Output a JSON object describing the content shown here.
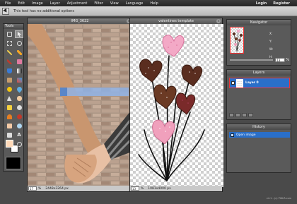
{
  "menu": {
    "items": [
      "File",
      "Edit",
      "Image",
      "Layer",
      "Adjustment",
      "Filter",
      "View",
      "Language",
      "Help"
    ],
    "right": [
      "Login",
      "Register"
    ]
  },
  "options": {
    "message": "This tool has no additional options"
  },
  "tools_panel": {
    "title": "Tools"
  },
  "canvas1": {
    "title": "IMG_3622",
    "zoom": "17",
    "zoom_unit": "%",
    "size": "2448x3264 px"
  },
  "canvas2": {
    "title": "valentines template",
    "zoom": "13",
    "zoom_unit": "%",
    "size": "1081x4000 px"
  },
  "navigator": {
    "title": "Navigator",
    "x_label": "X:",
    "y_label": "Y:",
    "w_label": "W:",
    "h_label": "H:",
    "zoom": "13",
    "zoom_unit": "%"
  },
  "layers": {
    "title": "Layers",
    "layer_name": "Layer 0"
  },
  "history": {
    "title": "History",
    "entry": "Open image"
  },
  "footer": {
    "text": "v4.1 - (c) PIXLR.com"
  },
  "colors": {
    "accent": "#2a6fc9",
    "highlight_border": "#e33333",
    "panel": "#5a5a5a"
  }
}
